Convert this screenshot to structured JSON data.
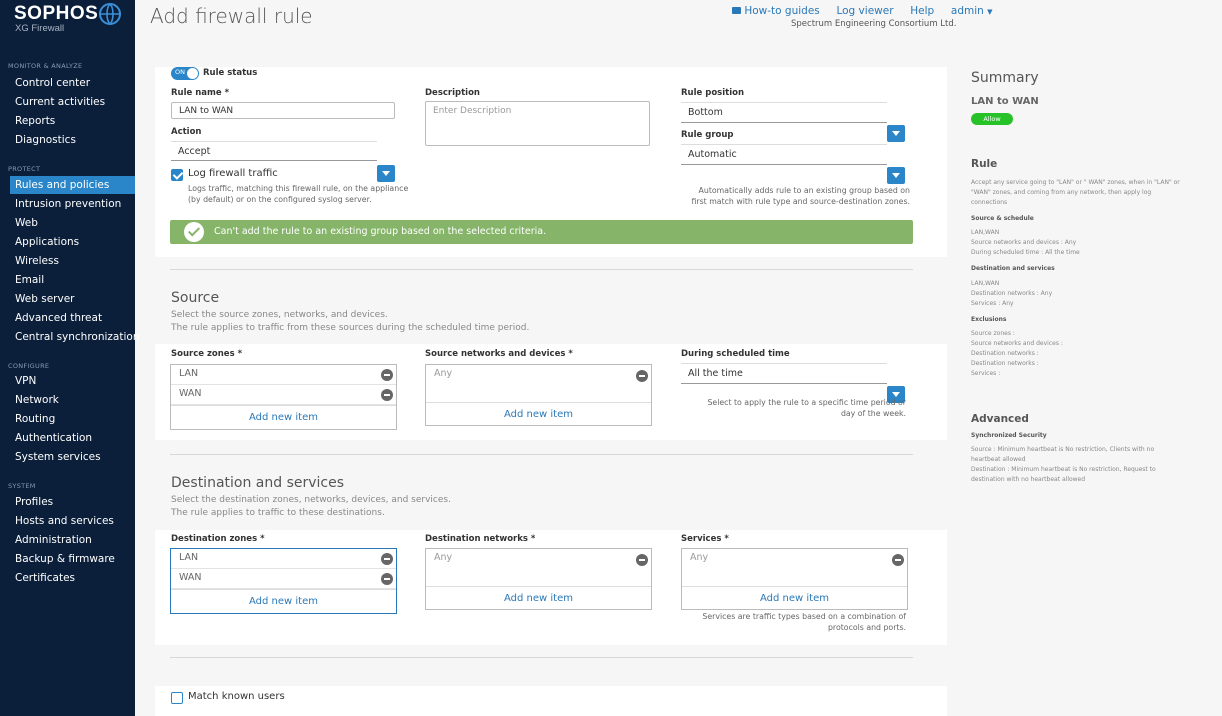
{
  "sidebar": {
    "brand": "SOPHOS",
    "product": "XG Firewall",
    "sections": {
      "monitor": "MONITOR & ANALYZE",
      "protect": "PROTECT",
      "configure": "CONFIGURE",
      "system": "SYSTEM"
    },
    "items": [
      {
        "label": "Control center"
      },
      {
        "label": "Current activities"
      },
      {
        "label": "Reports"
      },
      {
        "label": "Diagnostics"
      },
      {
        "label": "Rules and policies"
      },
      {
        "label": "Intrusion prevention"
      },
      {
        "label": "Web"
      },
      {
        "label": "Applications"
      },
      {
        "label": "Wireless"
      },
      {
        "label": "Email"
      },
      {
        "label": "Web server"
      },
      {
        "label": "Advanced threat"
      },
      {
        "label": "Central synchronization"
      },
      {
        "label": "VPN"
      },
      {
        "label": "Network"
      },
      {
        "label": "Routing"
      },
      {
        "label": "Authentication"
      },
      {
        "label": "System services"
      },
      {
        "label": "Profiles"
      },
      {
        "label": "Hosts and services"
      },
      {
        "label": "Administration"
      },
      {
        "label": "Backup & firmware"
      },
      {
        "label": "Certificates"
      }
    ],
    "active_item": "Rules and policies"
  },
  "header": {
    "title": "Add firewall rule",
    "links": {
      "howto": "How-to guides",
      "logviewer": "Log viewer",
      "help": "Help",
      "admin": "admin"
    },
    "org": "Spectrum Engineering Consortium Ltd."
  },
  "rule": {
    "status_toggle": "ON",
    "status_label": "Rule status",
    "name_label": "Rule name *",
    "name_value": "LAN to WAN",
    "description_label": "Description",
    "description_placeholder": "Enter Description",
    "action_label": "Action",
    "action_value": "Accept",
    "log_label": "Log firewall traffic",
    "log_checked": true,
    "log_help": "Logs traffic, matching this firewall rule, on the appliance (by default) or on the configured syslog server.",
    "position_label": "Rule position",
    "position_value": "Bottom",
    "group_label": "Rule group",
    "group_value": "Automatic",
    "group_help": "Automatically adds rule to an existing group based on first match with rule type and source-destination zones.",
    "alert": "Can't add the rule to an existing group based on the selected criteria."
  },
  "source": {
    "title": "Source",
    "desc1": "Select the source zones, networks, and devices.",
    "desc2": "The rule applies to traffic from these sources during the scheduled time period.",
    "zones_label": "Source zones *",
    "zones": [
      "LAN",
      "WAN"
    ],
    "networks_label": "Source networks and devices *",
    "networks": [
      "Any"
    ],
    "schedule_label": "During scheduled time",
    "schedule_value": "All the time",
    "schedule_help": "Select to apply the rule to a specific time period or day of the week.",
    "add_new": "Add new item"
  },
  "destination": {
    "title": "Destination and services",
    "desc1": "Select the destination zones, networks, devices, and services.",
    "desc2": "The rule applies to traffic to these destinations.",
    "zones_label": "Destination zones *",
    "zones": [
      "LAN",
      "WAN"
    ],
    "networks_label": "Destination networks *",
    "networks": [
      "Any"
    ],
    "services_label": "Services *",
    "services": [
      "Any"
    ],
    "services_help": "Services are traffic types based on a combination of protocols and ports.",
    "add_new": "Add new item"
  },
  "match_users": {
    "label": "Match known users",
    "checked": false
  },
  "summary": {
    "title": "Summary",
    "rule_name": "LAN to WAN",
    "badge": "Allow",
    "rule_heading": "Rule",
    "rule_text": "Accept any service going to \"LAN\" or \" WAN\" zones, when in \"LAN\" or \"WAN\" zones, and coming from any network, then apply log connections",
    "src_heading": "Source & schedule",
    "src_lines": [
      "LAN,WAN",
      "Source networks and devices : Any",
      "During scheduled time : All the time"
    ],
    "dst_heading": "Destination and services",
    "dst_lines": [
      "LAN,WAN",
      "Destination networks : Any",
      "Services : Any"
    ],
    "exc_heading": "Exclusions",
    "exc_lines": [
      "Source zones :",
      "Source networks and devices :",
      "Destination networks :",
      "Destination networks :",
      "Services :"
    ],
    "adv_heading": "Advanced",
    "sync_heading": "Synchronized Security",
    "sync_lines": [
      "Source : Minimum heartbeat is No restriction, Clients with no heartbeat allowed",
      "Destination : Minimum heartbeat is No restriction, Request to destination with no heartbeat allowed"
    ]
  },
  "colors": {
    "accent": "#2a86c8",
    "sidebar": "#0b1f3a",
    "alert": "#86b56a",
    "allow": "#27c227"
  }
}
